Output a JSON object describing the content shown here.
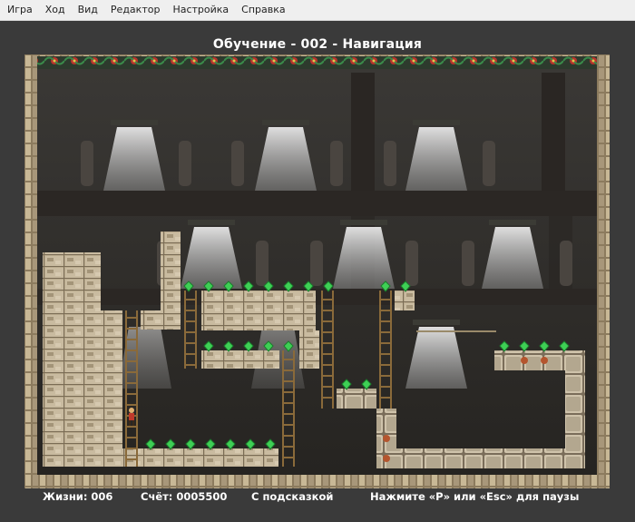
{
  "menu": [
    "Игра",
    "Ход",
    "Вид",
    "Редактор",
    "Настройка",
    "Справка"
  ],
  "level_title": "Обучение - 002 - Навигация",
  "status": {
    "lives": "Жизни: 006",
    "score": "Счёт: 0005500",
    "hint": "С подсказкой",
    "pause_hint": "Нажмите «P» или «Esc» для паузы"
  },
  "colors": {
    "panel_bg": "#3a3a3a",
    "wall_stone": "#b9aa8e",
    "gem_green": "#3ecf55",
    "ladder": "#8a6a3a"
  },
  "icons": [
    "gem-icon",
    "ladder-icon",
    "player-icon",
    "enemy-icon"
  ]
}
